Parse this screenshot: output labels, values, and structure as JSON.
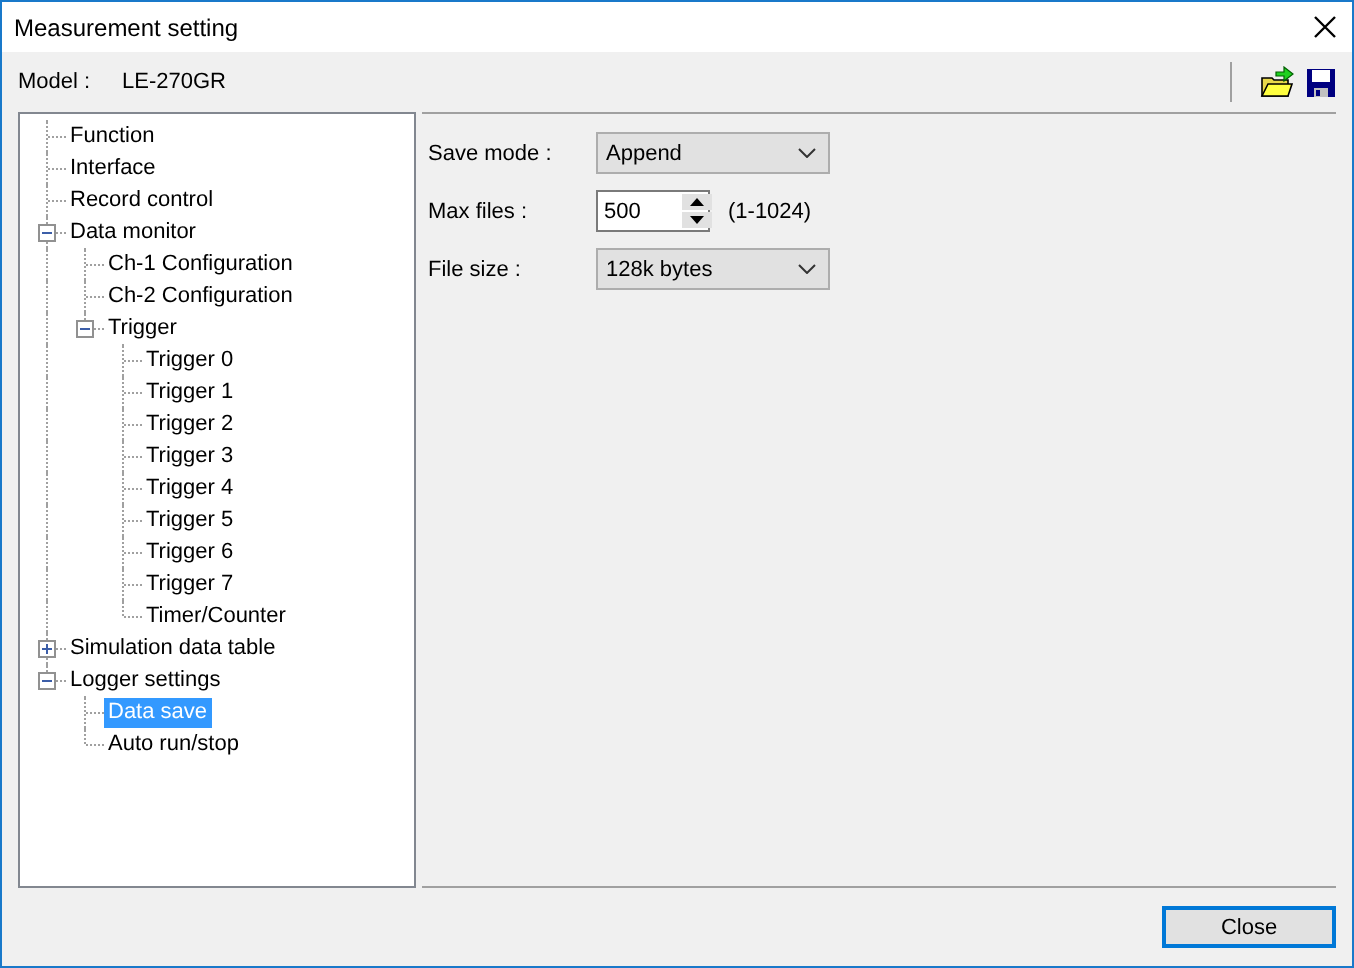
{
  "window": {
    "title": "Measurement setting"
  },
  "model": {
    "label": "Model :",
    "value": "LE-270GR"
  },
  "tree": [
    {
      "label": "Function",
      "selected": false
    },
    {
      "label": "Interface",
      "selected": false
    },
    {
      "label": "Record control",
      "selected": false
    },
    {
      "label": "Data monitor",
      "selected": false,
      "expanded": true,
      "children": [
        {
          "label": "Ch-1 Configuration",
          "selected": false
        },
        {
          "label": "Ch-2 Configuration",
          "selected": false
        },
        {
          "label": "Trigger",
          "selected": false,
          "expanded": true,
          "children": [
            {
              "label": "Trigger 0",
              "selected": false
            },
            {
              "label": "Trigger 1",
              "selected": false
            },
            {
              "label": "Trigger 2",
              "selected": false
            },
            {
              "label": "Trigger 3",
              "selected": false
            },
            {
              "label": "Trigger 4",
              "selected": false
            },
            {
              "label": "Trigger 5",
              "selected": false
            },
            {
              "label": "Trigger 6",
              "selected": false
            },
            {
              "label": "Trigger 7",
              "selected": false
            },
            {
              "label": "Timer/Counter",
              "selected": false
            }
          ]
        }
      ]
    },
    {
      "label": "Simulation data table",
      "selected": false,
      "expanded": false
    },
    {
      "label": "Logger settings",
      "selected": false,
      "expanded": true,
      "children": [
        {
          "label": "Data save",
          "selected": true
        },
        {
          "label": "Auto run/stop",
          "selected": false
        }
      ]
    }
  ],
  "settings": [
    {
      "kind": "combo",
      "label": "Save mode :",
      "value": "Append"
    },
    {
      "kind": "spin",
      "label": "Max files :",
      "value": "500",
      "note": "(1-1024)"
    },
    {
      "kind": "combo",
      "label": "File size :",
      "value": "128k bytes"
    }
  ],
  "buttons": [
    "Close"
  ]
}
